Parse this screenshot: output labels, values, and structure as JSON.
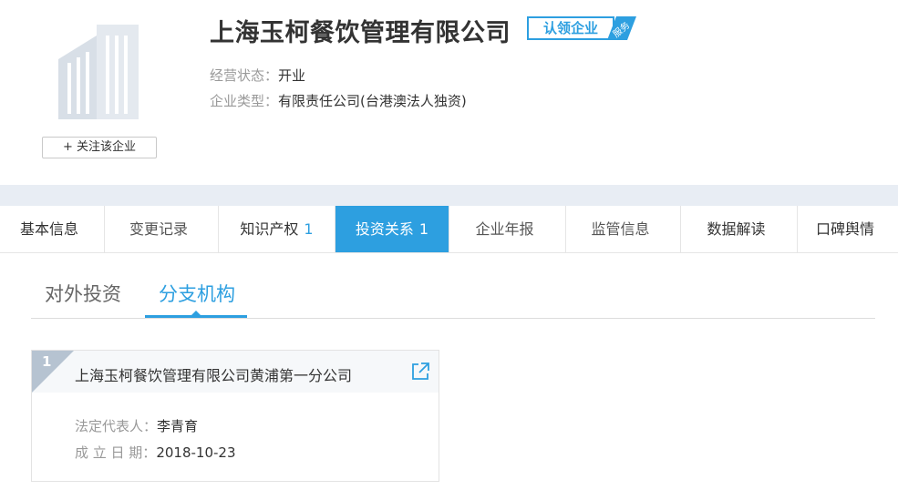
{
  "company": {
    "name": "上海玉柯餐饮管理有限公司",
    "claim_badge": "认领企业",
    "claim_flag": "服务",
    "follow_label": "+ 关注该企业",
    "status_label": "经营状态：",
    "status_value": "开业",
    "type_label": "企业类型：",
    "type_value": "有限责任公司(台港澳法人独资)"
  },
  "tabs": [
    {
      "label": "基本信息",
      "count": ""
    },
    {
      "label": "变更记录",
      "count": ""
    },
    {
      "label": "知识产权",
      "count": "1"
    },
    {
      "label": "投资关系",
      "count": "1"
    },
    {
      "label": "企业年报",
      "count": ""
    },
    {
      "label": "监管信息",
      "count": ""
    },
    {
      "label": "数据解读",
      "count": ""
    },
    {
      "label": "口碑舆情",
      "count": ""
    }
  ],
  "active_tab": "投资关系",
  "subtabs": [
    {
      "label": "对外投资"
    },
    {
      "label": "分支机构"
    }
  ],
  "active_subtab": "分支机构",
  "branches": [
    {
      "index": "1",
      "name": "上海玉柯餐饮管理有限公司黄浦第一分公司",
      "rep_label": "法定代表人：",
      "rep_value": "李青育",
      "date_label": "成 立 日 期：",
      "date_value": "2018-10-23"
    }
  ],
  "colors": {
    "accent": "#2d9fe0",
    "band": "#e8edf4",
    "corner": "#b6c3d1"
  },
  "icons": {
    "logo": "building-icon",
    "claim_flag": "ribbon-icon",
    "card_link": "external-link-icon"
  }
}
